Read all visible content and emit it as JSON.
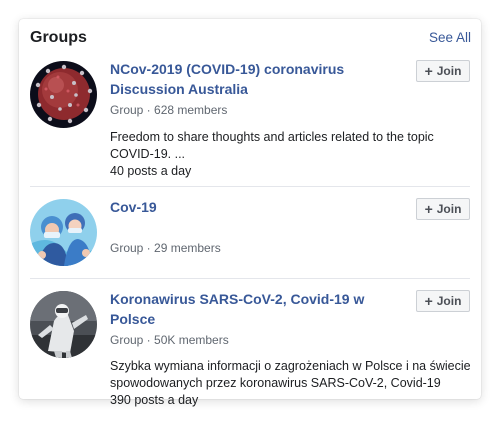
{
  "header": {
    "title": "Groups",
    "see_all": "See All"
  },
  "groups": [
    {
      "name": "NCov-2019 (COVID-19) coronavirus Discussion Australia",
      "meta": "Group · 628 members",
      "description": "Freedom to share thoughts and articles related to the topic COVID-19. ...",
      "activity": "40 posts a day",
      "join_label": "Join",
      "avatar_icon": "coronavirus-image"
    },
    {
      "name": "Cov-19",
      "meta": "Group · 29 members",
      "join_label": "Join",
      "avatar_icon": "illustration-image"
    },
    {
      "name": "Koronawirus SARS-CoV-2, Covid-19 w Polsce",
      "meta": "Group · 50K members",
      "description": "Szybka wymiana informacji o zagrożeniach w Polsce i na świecie spowodowanych przez koronawirus SARS-CoV-2, Covid-19",
      "activity": "390 posts a day",
      "join_label": "Join",
      "avatar_icon": "hazmat-photo"
    }
  ],
  "colors": {
    "link": "#385898",
    "text": "#1c1e21",
    "meta": "#606770"
  }
}
